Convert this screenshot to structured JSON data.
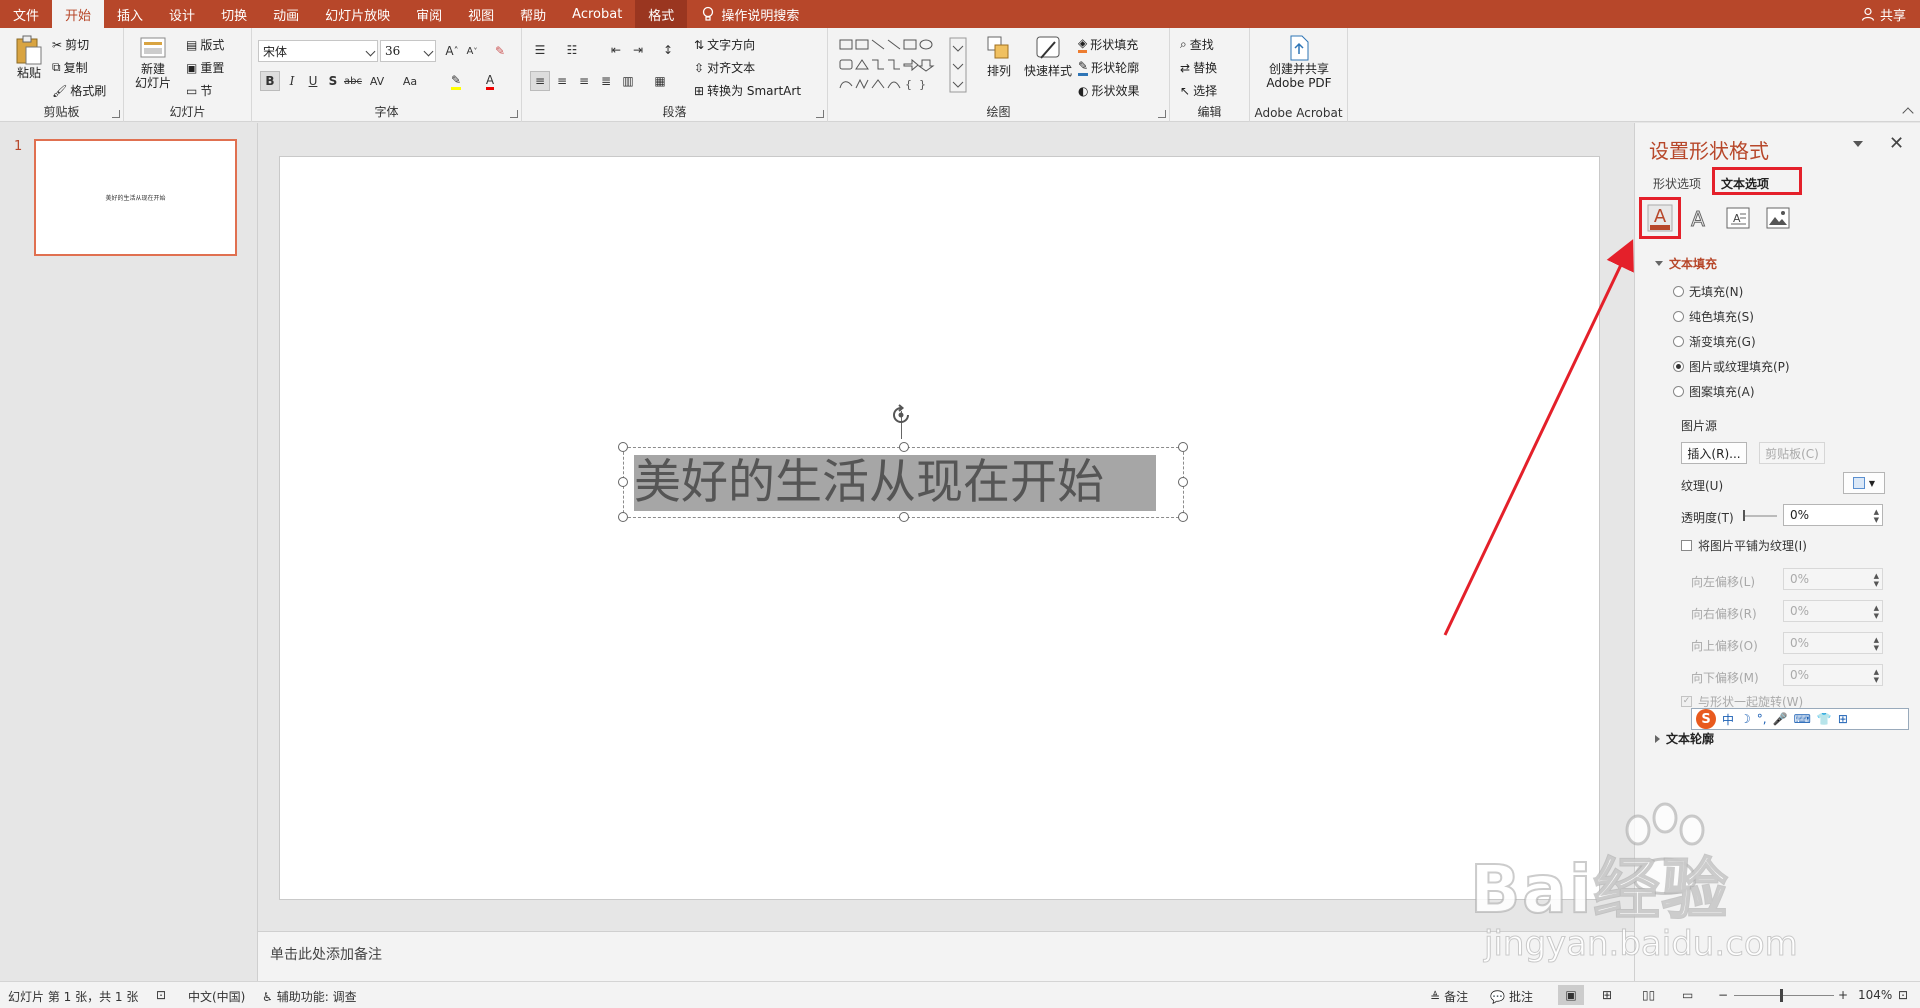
{
  "tabs": [
    {
      "label": "文件",
      "active": false
    },
    {
      "label": "开始",
      "active": true
    },
    {
      "label": "插入",
      "active": false
    },
    {
      "label": "设计",
      "active": false
    },
    {
      "label": "切换",
      "active": false
    },
    {
      "label": "动画",
      "active": false
    },
    {
      "label": "幻灯片放映",
      "active": false
    },
    {
      "label": "审阅",
      "active": false
    },
    {
      "label": "视图",
      "active": false
    },
    {
      "label": "帮助",
      "active": false
    },
    {
      "label": "Acrobat",
      "active": false
    },
    {
      "label": "格式",
      "active": false
    }
  ],
  "tell_me": "操作说明搜索",
  "share": "共享",
  "ribbon": {
    "clipboard": {
      "label": "剪贴板",
      "paste": "粘贴",
      "cut": "剪切",
      "copy": "复制",
      "format_painter": "格式刷"
    },
    "slides": {
      "label": "幻灯片",
      "new_slide": "新建\n幻灯片",
      "layout": "版式",
      "reset": "重置",
      "section": "节"
    },
    "font": {
      "label": "字体",
      "font_name": "宋体",
      "font_size": "36"
    },
    "paragraph": {
      "label": "段落",
      "text_direction": "文字方向",
      "align_text": "对齐文本",
      "smartart": "转换为 SmartArt"
    },
    "drawing": {
      "label": "绘图",
      "arrange": "排列",
      "quick_styles": "快速样式",
      "shape_fill": "形状填充",
      "shape_outline": "形状轮廓",
      "shape_effects": "形状效果"
    },
    "editing": {
      "label": "编辑",
      "find": "查找",
      "replace": "替换",
      "select": "选择"
    },
    "acrobat": {
      "label": "Adobe Acrobat",
      "create_share": "创建并共享\nAdobe PDF"
    }
  },
  "slide_number": "1",
  "thumb_text": "美好的生活从现在开始",
  "slide_text": "美好的生活从现在开始",
  "notes_placeholder": "单击此处添加备注",
  "pane": {
    "title": "设置形状格式",
    "tab_shape": "形状选项",
    "tab_text": "文本选项",
    "text_fill_header": "文本填充",
    "fill_options": [
      {
        "label": "无填充(N)",
        "selected": false
      },
      {
        "label": "纯色填充(S)",
        "selected": false
      },
      {
        "label": "渐变填充(G)",
        "selected": false
      },
      {
        "label": "图片或纹理填充(P)",
        "selected": true
      },
      {
        "label": "图案填充(A)",
        "selected": false
      }
    ],
    "picture_source": "图片源",
    "insert_btn": "插入(R)...",
    "clipboard_btn": "剪贴板(C)",
    "texture": "纹理(U)",
    "transparency": "透明度(T)",
    "transparency_value": "0%",
    "tile_checkbox": "将图片平铺为纹理(I)",
    "offsets": [
      {
        "label": "向左偏移(L)",
        "value": "0%"
      },
      {
        "label": "向右偏移(R)",
        "value": "0%"
      },
      {
        "label": "向上偏移(O)",
        "value": "0%"
      },
      {
        "label": "向下偏移(M)",
        "value": "0%"
      }
    ],
    "rotate_with_shape": "与形状一起旋转(W)",
    "text_outline_header": "文本轮廓",
    "ime_label": "中"
  },
  "status": {
    "slide_info": "幻灯片 第 1 张，共 1 张",
    "language": "中文(中国)",
    "accessibility": "辅助功能: 调查",
    "notes": "备注",
    "comments": "批注",
    "zoom": "104%"
  },
  "watermark": {
    "main": "Bai经验",
    "sub": "jingyan.baidu.com"
  },
  "colors": {
    "accent": "#b7472a",
    "highlight_box": "#e4202a"
  }
}
